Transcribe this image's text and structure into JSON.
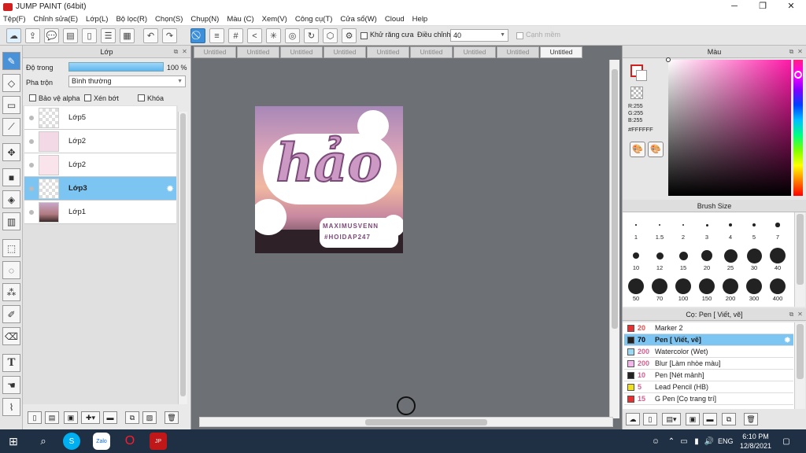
{
  "window": {
    "title": "JUMP PAINT (64bit)",
    "controls": [
      "─",
      "❐",
      "✕"
    ]
  },
  "menu": [
    "Tệp(F)",
    "Chỉnh sửa(E)",
    "Lớp(L)",
    "Bộ lọc(R)",
    "Chọn(S)",
    "Chụp(N)",
    "Màu (C)",
    "Xem(V)",
    "Công cụ(T)",
    "Cửa sổ(W)",
    "Cloud",
    "Help"
  ],
  "toolbar": {
    "antialias_label": "Khử răng cưa",
    "adjust_label": "Điều chỉnh",
    "adjust_value": "40",
    "snap_label": "Cạnh mềm"
  },
  "layer_panel": {
    "title": "Lớp",
    "opacity_label": "Độ trong",
    "opacity_value": "100 %",
    "opacity_percent": 100,
    "blend_label": "Pha trộn",
    "blend_value": "Bình thường",
    "protect_alpha": "Bảo vệ alpha",
    "clipping": "Xén bớt",
    "lock": "Khóa",
    "layers": [
      {
        "name": "Lớp5",
        "active": false
      },
      {
        "name": "Lớp2",
        "active": false
      },
      {
        "name": "Lớp2",
        "active": false
      },
      {
        "name": "Lớp3",
        "active": true
      },
      {
        "name": "Lớp1",
        "active": false
      }
    ]
  },
  "tabs": [
    "Untitled",
    "Untitled",
    "Untitled",
    "Untitled",
    "Untitled",
    "Untitled",
    "Untitled",
    "Untitled",
    "Untitled"
  ],
  "artwork": {
    "main_text": "hảo",
    "sub_text_1": "MAXIMUSVENN",
    "sub_text_2": "#HOIDAP247"
  },
  "color_panel": {
    "title": "Màu",
    "r": "R:255",
    "g": "G:255",
    "b": "B:255",
    "hex": "#FFFFFF"
  },
  "brush_size": {
    "title": "Brush Size",
    "sizes": [
      "1",
      "1.5",
      "2",
      "3",
      "4",
      "5",
      "7",
      "10",
      "12",
      "15",
      "20",
      "25",
      "30",
      "40",
      "50",
      "70",
      "100",
      "150",
      "200",
      "300",
      "400"
    ]
  },
  "pen_panel": {
    "title": "Cọ: Pen [ Viết, vẽ]",
    "pens": [
      {
        "num": "20",
        "label": "Marker 2",
        "color": "#e83030",
        "active": false
      },
      {
        "num": "70",
        "label": "Pen [ Viết, vẽ]",
        "color": "#222222",
        "active": true
      },
      {
        "num": "200",
        "label": "Watercolor (Wet)",
        "color": "#9ad8f4",
        "active": false
      },
      {
        "num": "200",
        "label": "Blur [Làm nhòe màu]",
        "color": "#f4b4ec",
        "active": false
      },
      {
        "num": "10",
        "label": "Pen [Nét mảnh]",
        "color": "#222222",
        "active": false
      },
      {
        "num": "5",
        "label": "Lead Pencil (HB)",
        "color": "#f0e020",
        "active": false
      },
      {
        "num": "15",
        "label": "G Pen [Cọ trang trí]",
        "color": "#e83030",
        "active": false
      }
    ]
  },
  "taskbar": {
    "lang": "ENG",
    "time": "6:10 PM",
    "date": "12/8/2021"
  }
}
